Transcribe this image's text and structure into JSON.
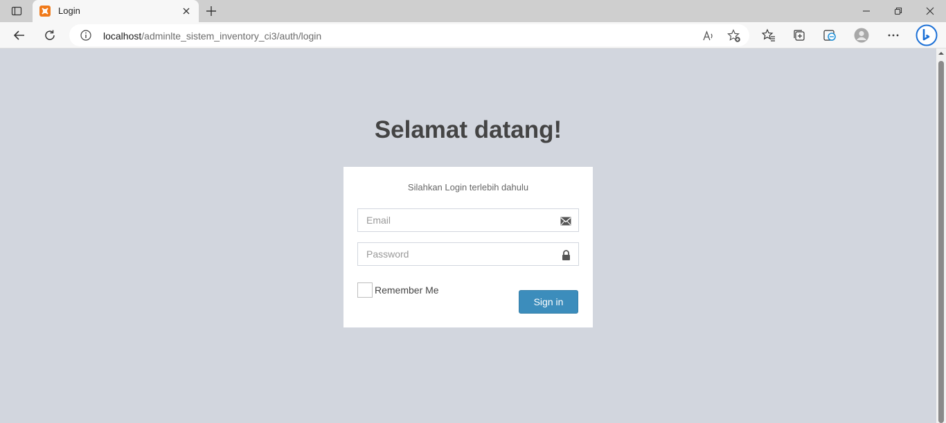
{
  "browser": {
    "tab": {
      "title": "Login",
      "favicon": "xampp-icon"
    },
    "address": {
      "host": "localhost",
      "path": "/adminlte_sistem_inventory_ci3/auth/login"
    }
  },
  "page": {
    "heading": "Selamat datang!",
    "login_message": "Silahkan Login terlebih dahulu",
    "email": {
      "placeholder": "Email",
      "value": "",
      "icon": "envelope-icon"
    },
    "password": {
      "placeholder": "Password",
      "value": "",
      "icon": "lock-icon"
    },
    "remember_label": "Remember Me",
    "remember_checked": false,
    "signin_label": "Sign in"
  },
  "colors": {
    "page_background": "#d2d6de",
    "primary_button": "#3c8dbc",
    "heading_text": "#444444"
  }
}
